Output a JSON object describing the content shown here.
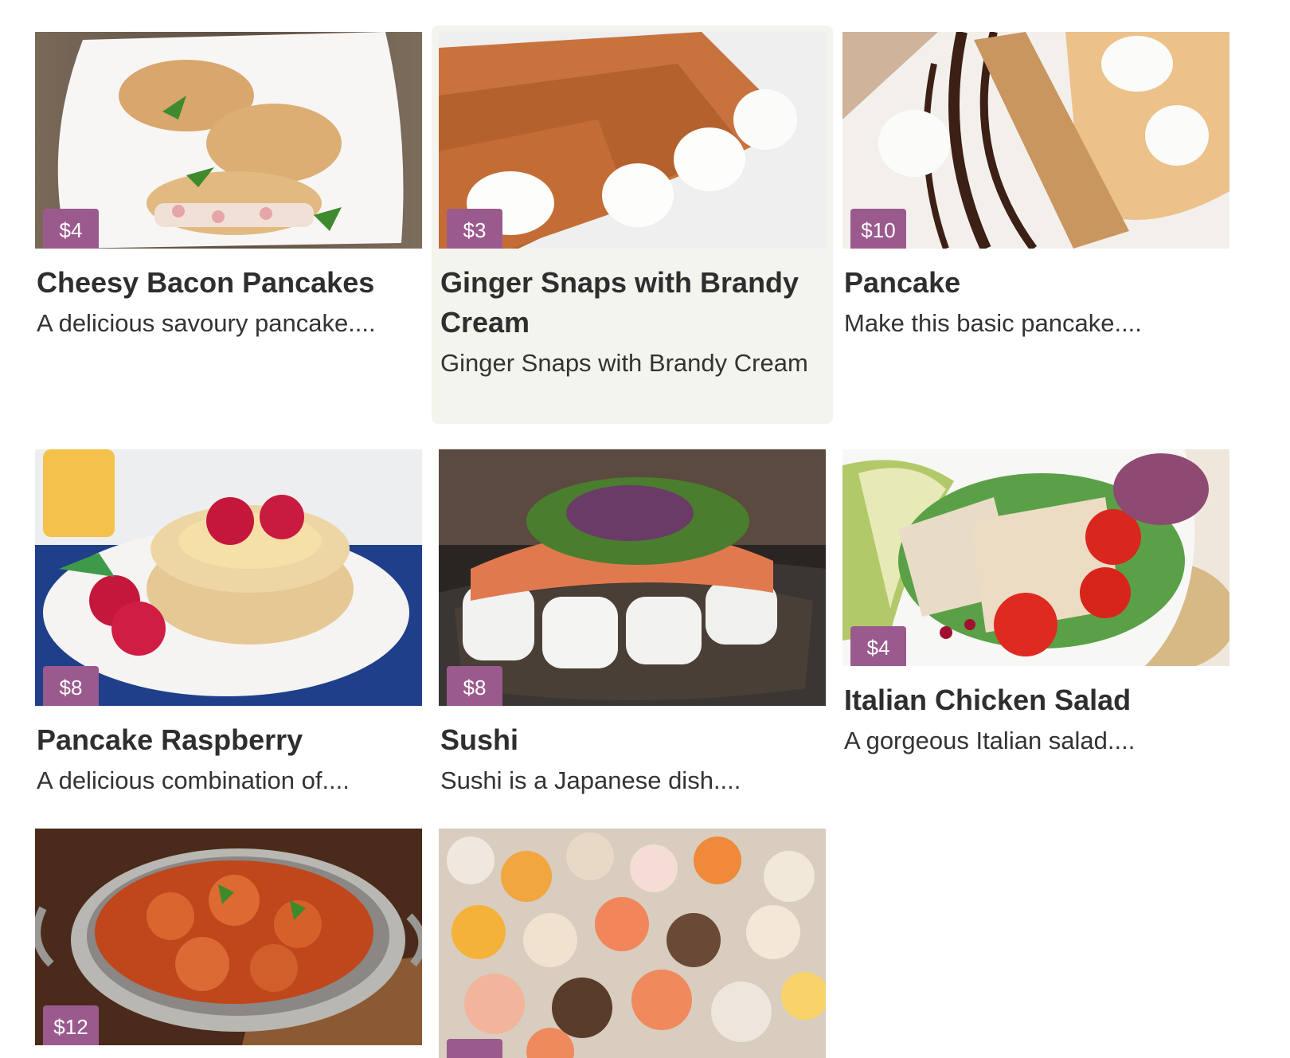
{
  "items": [
    {
      "price": "$4",
      "title": "Cheesy Bacon Pancakes",
      "description": "A delicious savoury pancake....",
      "image_icon": "pancake-photo-icon"
    },
    {
      "price": "$3",
      "title": "Ginger Snaps with Brandy Cream",
      "description": "Ginger Snaps with Brandy Cream",
      "image_icon": "ginger-snaps-photo-icon"
    },
    {
      "price": "$10",
      "title": "Pancake",
      "description": "Make this basic pancake....",
      "image_icon": "crepe-photo-icon"
    },
    {
      "price": "$8",
      "title": "Pancake Raspberry",
      "description": "A delicious combination of....",
      "image_icon": "pancake-stack-photo-icon"
    },
    {
      "price": "$8",
      "title": "Sushi",
      "description": "Sushi is a Japanese dish....",
      "image_icon": "sushi-photo-icon"
    },
    {
      "price": "$4",
      "title": "Italian Chicken Salad",
      "description": "A gorgeous Italian salad....",
      "image_icon": "salad-photo-icon"
    },
    {
      "price": "$12",
      "title": "",
      "description": "",
      "image_icon": "curry-photo-icon"
    },
    {
      "price": "",
      "title": "",
      "description": "",
      "image_icon": "canapes-photo-icon"
    }
  ],
  "colors": {
    "price_badge": "#9b5a8e",
    "hover_background": "#f4f4ee"
  }
}
